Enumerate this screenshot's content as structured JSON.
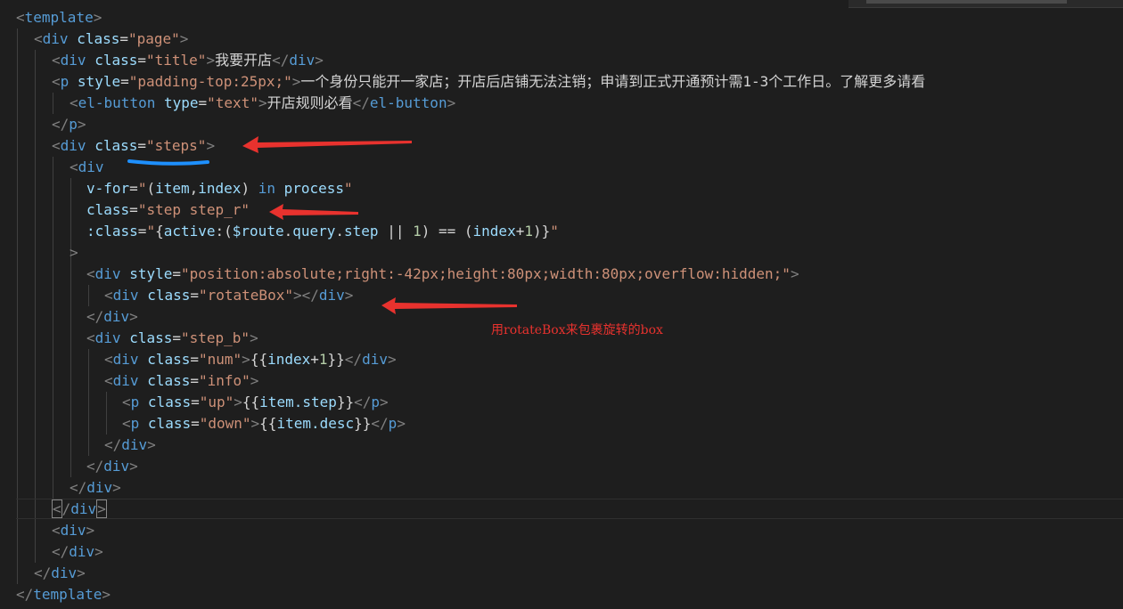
{
  "code": {
    "l1_tag": "template",
    "l2_tag": "div",
    "l2_attr": "class",
    "l2_val": "\"page\"",
    "l3_tag": "div",
    "l3_attr": "class",
    "l3_val": "\"title\"",
    "l3_text": "我要开店",
    "l4_tag": "p",
    "l4_attr": "style",
    "l4_val": "\"padding-top:25px;\"",
    "l4_text": "一个身份只能开一家店；开店后店铺无法注销；申请到正式开通预计需1-3个工作日。了解更多请看",
    "l5_tag": "el-button",
    "l5_attr": "type",
    "l5_val": "\"text\"",
    "l5_text": "开店规则必看",
    "l6_tag": "p",
    "l7_tag": "div",
    "l7_attr": "class",
    "l7_val": "\"steps\"",
    "l8_tag": "div",
    "l9_attr": "v-for",
    "l9_item": "item",
    "l9_index": "index",
    "l9_in": "in",
    "l9_process": "process",
    "l10_attr": "class",
    "l10_val": "\"step step_r\"",
    "l11_attr": ":class",
    "l11_key": "active",
    "l11_route": "$route",
    "l11_query": "query",
    "l11_step": "step",
    "l11_one": "1",
    "l11_index": "index",
    "l11_one2": "1",
    "l13_tag": "div",
    "l13_attr": "style",
    "l13_val": "\"position:absolute;right:-42px;height:80px;width:80px;overflow:hidden;\"",
    "l14_tag": "div",
    "l14_attr": "class",
    "l14_val": "\"rotateBox\"",
    "l15_tag": "div",
    "l16_tag": "div",
    "l16_attr": "class",
    "l16_val": "\"step_b\"",
    "l17_tag": "div",
    "l17_attr": "class",
    "l17_val": "\"num\"",
    "l17_expr_a": "index",
    "l17_expr_b": "1",
    "l18_tag": "div",
    "l18_attr": "class",
    "l18_val": "\"info\"",
    "l19_tag": "p",
    "l19_attr": "class",
    "l19_val": "\"up\"",
    "l19_expr": "item.step",
    "l20_tag": "p",
    "l20_attr": "class",
    "l20_val": "\"down\"",
    "l20_expr": "item.desc",
    "l21_tag": "div",
    "l22_tag": "div",
    "l23_tag": "div",
    "l24_tag": "div",
    "l25_tag": "div",
    "l26_tag": "div",
    "l27_tag": "div",
    "l28_tag": "template"
  },
  "annotation": {
    "text": "用rotateBox来包裹旋转的box",
    "color": "#e8322e"
  },
  "colors": {
    "background": "#1e1e1e",
    "tag": "#569cd6",
    "attribute": "#9cdcfe",
    "string": "#ce9178",
    "arrow": "#e8322e",
    "underline": "#1e90ff"
  }
}
